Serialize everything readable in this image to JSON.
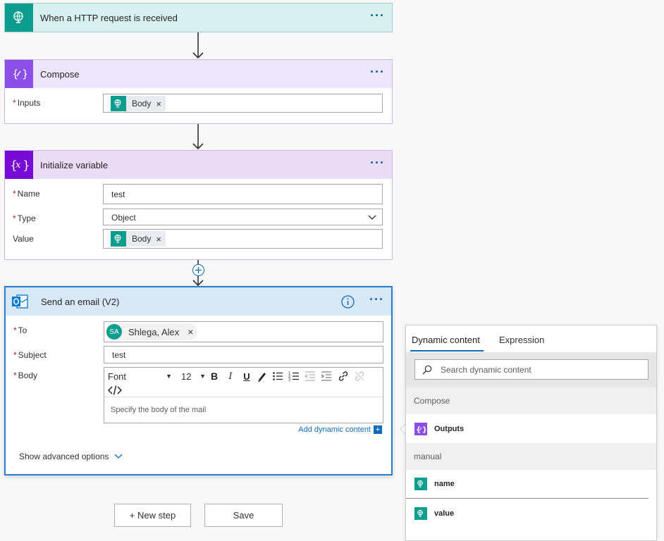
{
  "trigger": {
    "title": "When a HTTP request is received"
  },
  "compose": {
    "title": "Compose",
    "inputs_label": "Inputs",
    "inputs_token": "Body"
  },
  "init_var": {
    "title": "Initialize variable",
    "name_label": "Name",
    "name_value": "test",
    "type_label": "Type",
    "type_value": "Object",
    "value_label": "Value",
    "value_token": "Body"
  },
  "email": {
    "title": "Send an email (V2)",
    "to_label": "To",
    "to_initials": "SA",
    "to_name": "Shlega, Alex",
    "subject_label": "Subject",
    "subject_value": "test",
    "body_label": "Body",
    "font_select": "Font",
    "size_select": "12",
    "body_placeholder": "Specify the body of the mail",
    "add_dynamic": "Add dynamic content",
    "show_advanced": "Show advanced options"
  },
  "buttons": {
    "new_step": "+ New step",
    "save": "Save"
  },
  "panel": {
    "tab_dynamic": "Dynamic content",
    "tab_expression": "Expression",
    "search_placeholder": "Search dynamic content",
    "section_compose": "Compose",
    "item_outputs": "Outputs",
    "section_manual": "manual",
    "item_name": "name",
    "item_value": "value"
  },
  "colors": {
    "http_trigger": "#0c9d8f",
    "compose": "#8b4fe8",
    "variable": "#770bd6",
    "outlook": "#0078d4",
    "link": "#0f6cbd"
  }
}
